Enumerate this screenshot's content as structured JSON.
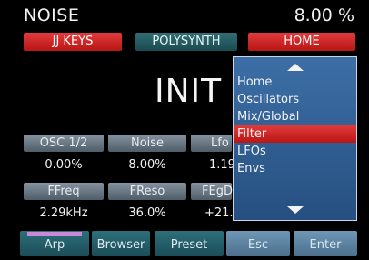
{
  "header": {
    "param_name": "NOISE",
    "param_value": "8.00 %"
  },
  "topbar": {
    "left": "JJ KEYS",
    "center": "POLYSYNTH",
    "right": "HOME"
  },
  "preset": {
    "name": "INIT"
  },
  "knobs_row1": [
    {
      "label": "OSC 1/2",
      "value": "0.00%"
    },
    {
      "label": "Noise",
      "value": "8.00%"
    },
    {
      "label": "Lfo",
      "value": "1.19"
    }
  ],
  "knobs_row2": [
    {
      "label": "FFreq",
      "value": "2.29kHz"
    },
    {
      "label": "FReso",
      "value": "36.0%"
    },
    {
      "label": "FEgD",
      "value": "+21."
    }
  ],
  "menu": {
    "items": [
      "Home",
      "Oscillators",
      "Mix/Global",
      "Filter",
      "LFOs",
      "Envs"
    ],
    "selected": "Filter"
  },
  "bottombar": {
    "arp": "Arp",
    "browser": "Browser",
    "preset": "Preset",
    "esc": "Esc",
    "enter": "Enter"
  },
  "colors": {
    "red": "#d12424",
    "teal": "#24606a",
    "menu_blue": "#2f5f95",
    "arp_indicator": "#c889d8"
  }
}
